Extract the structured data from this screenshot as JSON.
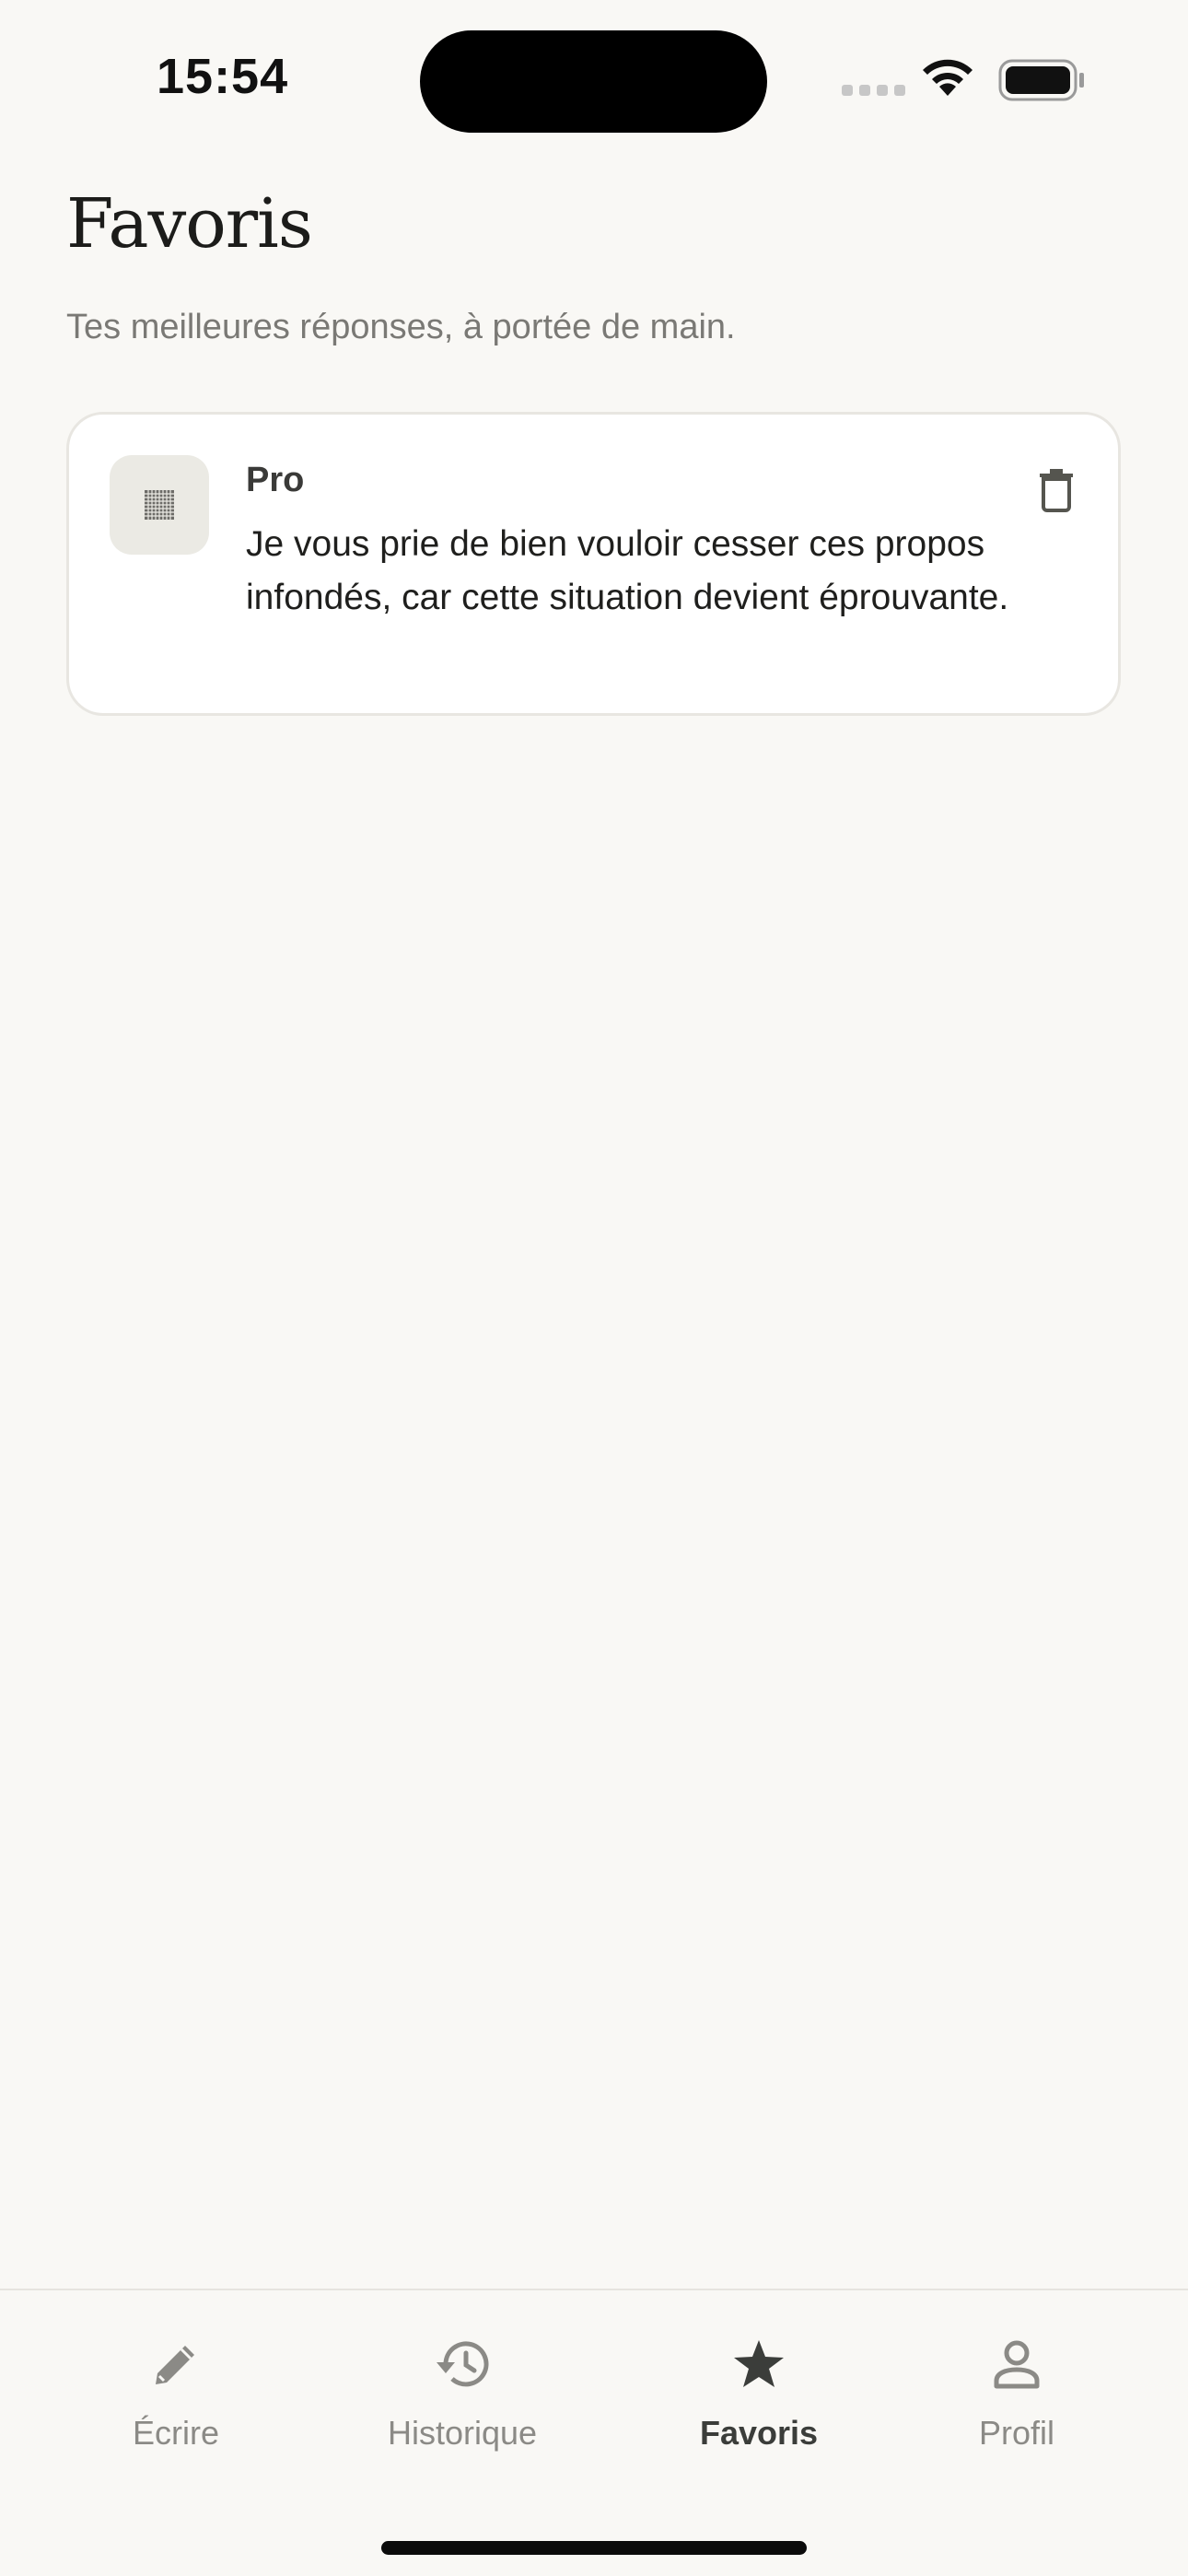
{
  "status_bar": {
    "time": "15:54"
  },
  "header": {
    "title": "Favoris",
    "subtitle": "Tes meilleures réponses, à portée de main."
  },
  "favorites": [
    {
      "category": "Pro",
      "thumb_icon": "grid-icon",
      "text": "Je vous prie de bien vouloir cesser ces propos infondés, car cette situation devient éprouvante."
    }
  ],
  "tabs": [
    {
      "label": "Écrire",
      "icon": "pencil-icon",
      "active": false
    },
    {
      "label": "Historique",
      "icon": "history-icon",
      "active": false
    },
    {
      "label": "Favoris",
      "icon": "star-icon",
      "active": true
    },
    {
      "label": "Profil",
      "icon": "person-icon",
      "active": false
    }
  ],
  "colors": {
    "background": "#f9f8f5",
    "card": "#ffffff",
    "active_tab": "#3b3d3a",
    "inactive_tab": "#8b8a86"
  }
}
